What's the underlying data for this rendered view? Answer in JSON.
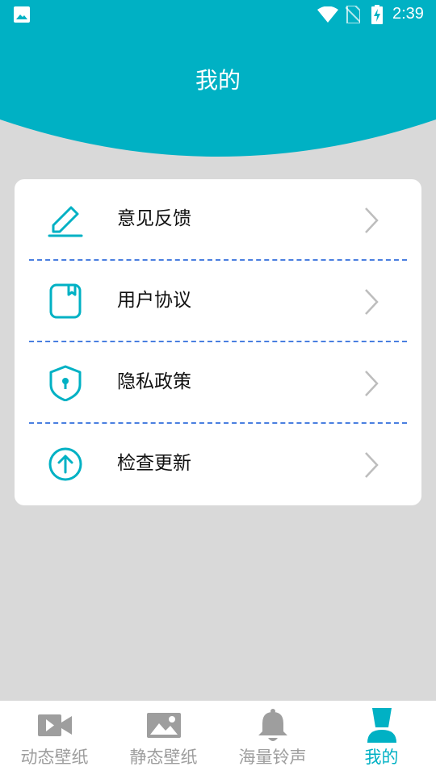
{
  "status_bar": {
    "time": "2:39"
  },
  "header": {
    "title": "我的",
    "color": "#00b1c4"
  },
  "menu": {
    "items": [
      {
        "label": "意见反馈",
        "icon": "edit-icon"
      },
      {
        "label": "用户协议",
        "icon": "agreement-icon"
      },
      {
        "label": "隐私政策",
        "icon": "shield-icon"
      },
      {
        "label": "检查更新",
        "icon": "upload-arrow-icon"
      }
    ]
  },
  "bottom_nav": {
    "items": [
      {
        "label": "动态壁纸",
        "icon": "video-camera-icon",
        "active": false
      },
      {
        "label": "静态壁纸",
        "icon": "image-icon",
        "active": false
      },
      {
        "label": "海量铃声",
        "icon": "bell-icon",
        "active": false
      },
      {
        "label": "我的",
        "icon": "user-icon",
        "active": true
      }
    ],
    "active_color": "#00b1c4",
    "inactive_color": "#9e9e9e"
  }
}
